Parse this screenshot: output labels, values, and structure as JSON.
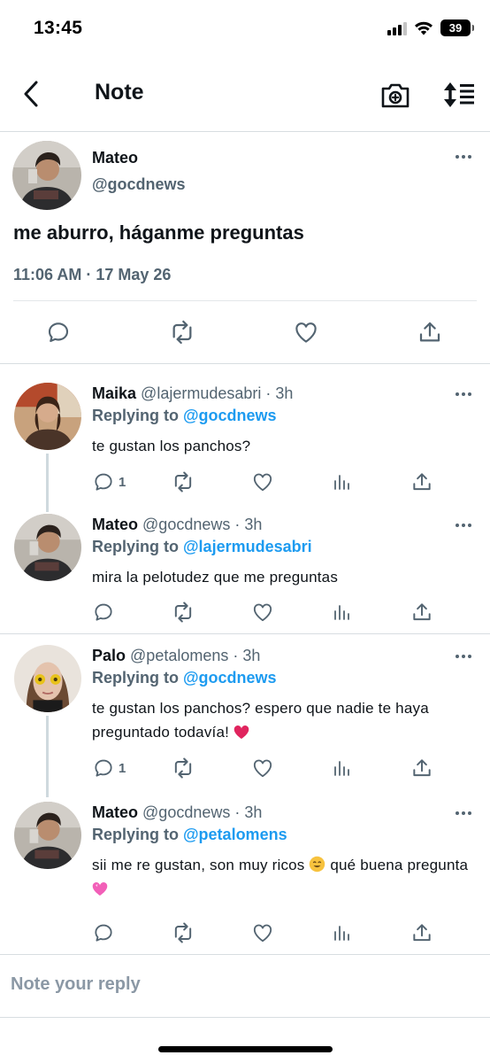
{
  "status_bar": {
    "time": "13:45",
    "battery": "39"
  },
  "header": {
    "title": "Note"
  },
  "main_post": {
    "name": "Mateo",
    "handle": "@gocdnews",
    "text": "me aburro, háganme preguntas",
    "timestamp": "11:06 AM · 17 May 26"
  },
  "replies": [
    {
      "name": "Maika",
      "meta": "@lajermudesabri · 3h",
      "replying_prefix": "Replying to ",
      "replying_to": "@gocdnews",
      "text": "te gustan los panchos?",
      "reply_count": "1"
    },
    {
      "name": "Mateo",
      "meta": "@gocdnews · 3h",
      "replying_prefix": "Replying to ",
      "replying_to": "@lajermudesabri",
      "text": "mira la pelotudez que me preguntas",
      "reply_count": ""
    },
    {
      "name": "Palo",
      "meta": "@petalomens · 3h",
      "replying_prefix": "Replying to ",
      "replying_to": "@gocdnews",
      "text": "te gustan los panchos? espero que nadie te haya preguntado todavía!",
      "reply_count": "1",
      "emoji": "red-heart"
    },
    {
      "name": "Mateo",
      "meta": "@gocdnews · 3h",
      "replying_prefix": "Replying to ",
      "replying_to": "@petalomens",
      "text_part1": "sii me re gustan, son muy ricos",
      "text_part2": " qué buena pregunta",
      "reply_count": "",
      "emoji1": "smiling-face",
      "emoji2": "pink-heart"
    }
  ],
  "composer": {
    "placeholder": "Note your reply"
  },
  "colors": {
    "accent": "#1d9bf0",
    "muted": "#536471",
    "text": "#0f1419",
    "divider": "#d8dde1"
  }
}
